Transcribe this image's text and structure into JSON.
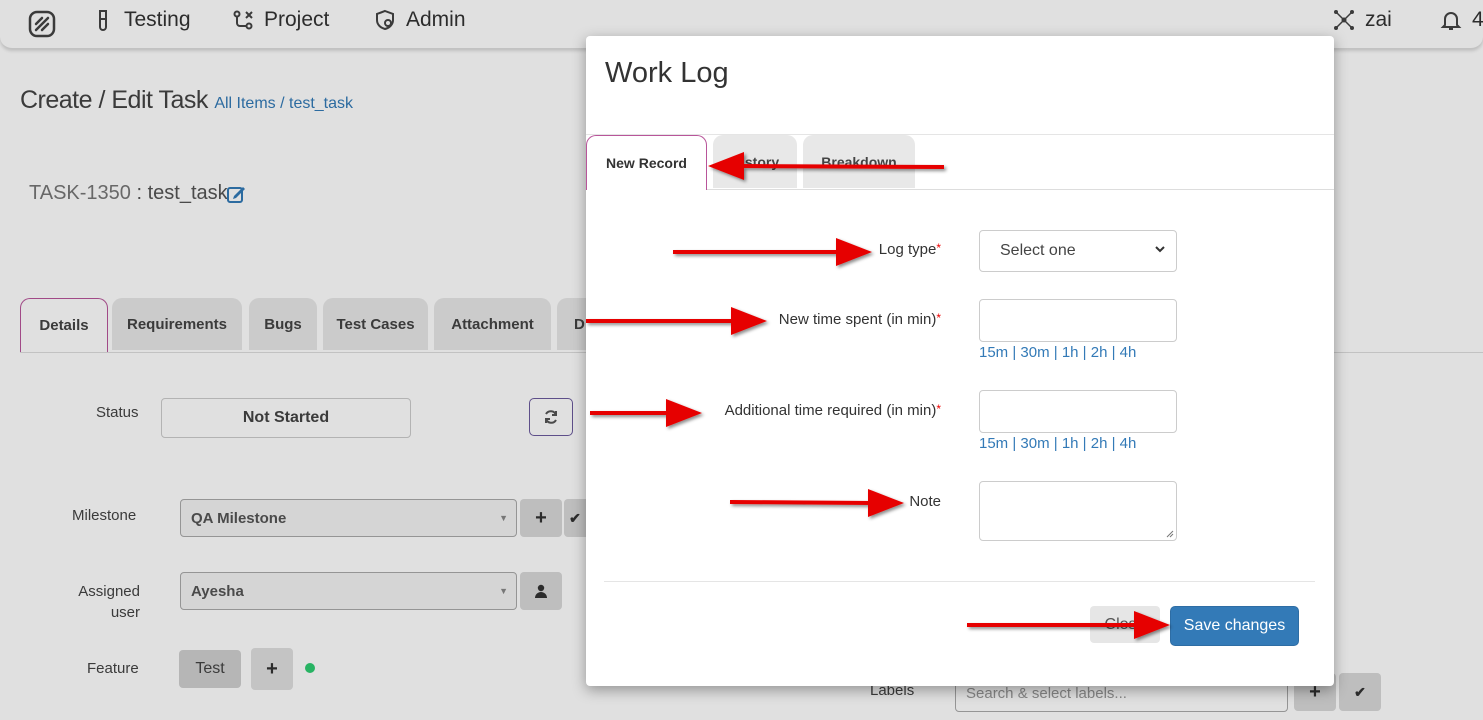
{
  "topnav": {
    "items": [
      {
        "label": "Testing",
        "icon": "flask-icon"
      },
      {
        "label": "Project",
        "icon": "git-branch-icon"
      },
      {
        "label": "Admin",
        "icon": "shield-cog-icon"
      }
    ],
    "user": "zai",
    "notification_count": "4"
  },
  "page": {
    "title": "Create / Edit Task",
    "breadcrumb": "All Items / test_task",
    "task_key": "TASK-1350",
    "task_separator": " : ",
    "task_name": "test_task",
    "tabs": [
      "Details",
      "Requirements",
      "Bugs",
      "Test Cases",
      "Attachment",
      "D"
    ],
    "status_label": "Status",
    "status_value": "Not Started",
    "milestone_label": "Milestone",
    "milestone_value": "QA Milestone",
    "assigned_label_1": "Assigned",
    "assigned_label_2": "user",
    "assigned_value": "Ayesha",
    "feature_label": "Feature",
    "feature_value": "Test",
    "labels_label": "Labels",
    "labels_placeholder": "Search & select labels..."
  },
  "modal": {
    "title": "Work Log",
    "tabs": [
      "New Record",
      "History",
      "Breakdown"
    ],
    "log_type_label": "Log type",
    "log_type_placeholder": "Select one",
    "new_time_label": "New time spent (in min)",
    "additional_time_label": "Additional time required (in min)",
    "note_label": "Note",
    "required_marker": "*",
    "quick_times": "15m | 30m | 1h | 2h | 4h",
    "close_label": "Close",
    "save_label": "Save changes"
  },
  "colors": {
    "accent": "#337ab7",
    "active_tab_border": "#b8559a",
    "annotation_arrow": "#e60000",
    "status_dot": "#2ecc71"
  }
}
